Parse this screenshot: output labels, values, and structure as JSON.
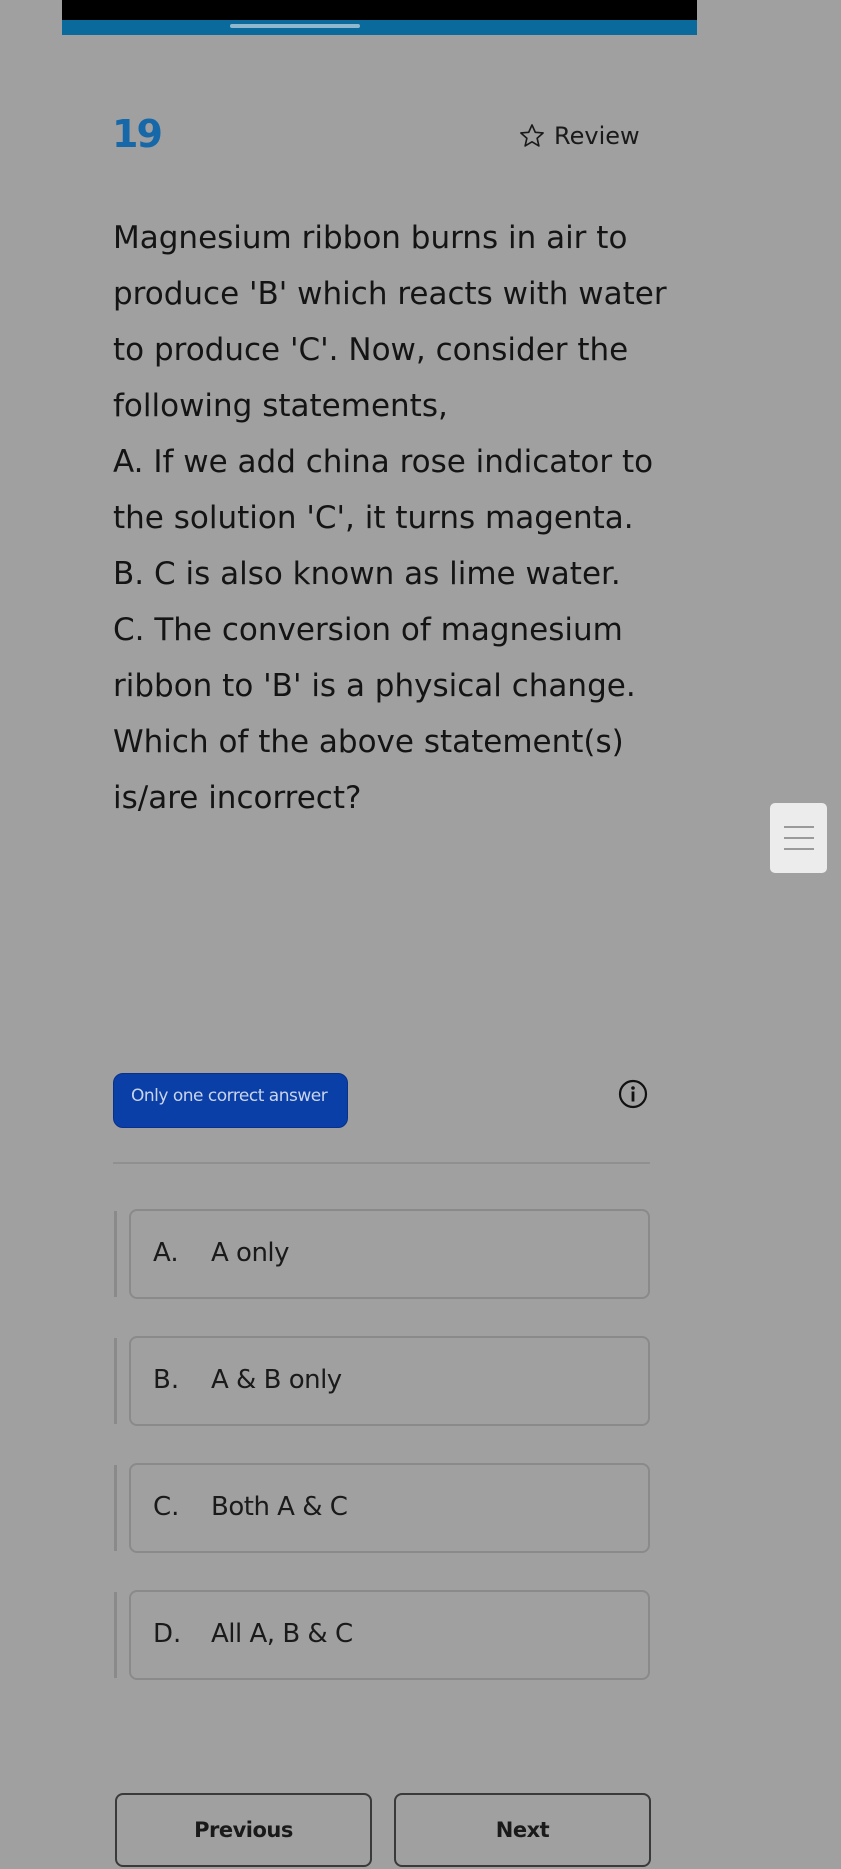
{
  "header": {
    "question_number": "19",
    "review_label": "Review",
    "review_icon": "star-outline-icon"
  },
  "question": {
    "paragraphs": [
      "Magnesium ribbon burns in air to produce 'B' which reacts with water to produce 'C'. Now, consider the following statements,",
      "A. If we add china rose indicator to the solution 'C', it turns magenta.",
      "B. C is also known as lime water.",
      "C. The conversion of magnesium ribbon to 'B' is a physical change.",
      "Which of the above statement(s) is/are incorrect?"
    ]
  },
  "answer_type": {
    "label": "Only one correct answer",
    "info_icon": "info-circle-icon"
  },
  "options": [
    {
      "letter": "A.",
      "text": "A only"
    },
    {
      "letter": "B.",
      "text": "A & B only"
    },
    {
      "letter": "C.",
      "text": "Both A & C"
    },
    {
      "letter": "D.",
      "text": "All A, B & C"
    }
  ],
  "navigation": {
    "previous_label": "Previous",
    "next_label": "Next"
  },
  "side_panel": {
    "icon": "menu-lines-icon"
  },
  "colors": {
    "accent": "#1768a8",
    "badge_bg": "#0a3fa8",
    "background": "#a0a0a0"
  }
}
